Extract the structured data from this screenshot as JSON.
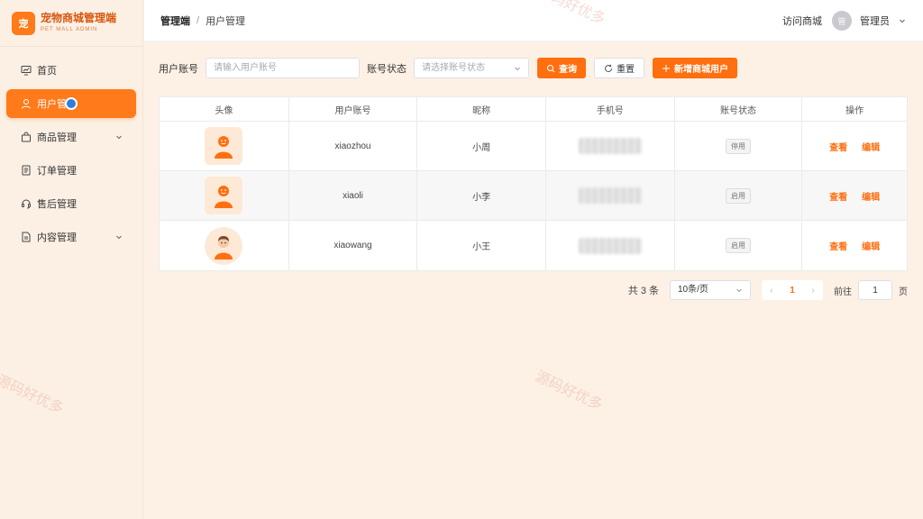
{
  "brand": {
    "logo_char": "宠",
    "title": "宠物商城管理端",
    "subtitle": "PET MALL ADMIN"
  },
  "sidebar": {
    "items": [
      {
        "label": "首页",
        "icon": "dashboard-icon",
        "active": false
      },
      {
        "label": "用户管",
        "icon": "user-icon",
        "active": true
      },
      {
        "label": "商品管理",
        "icon": "bag-icon",
        "active": false,
        "expandable": true
      },
      {
        "label": "订单管理",
        "icon": "document-icon",
        "active": false
      },
      {
        "label": "售后管理",
        "icon": "headset-icon",
        "active": false
      },
      {
        "label": "内容管理",
        "icon": "file-icon",
        "active": false,
        "expandable": true
      }
    ]
  },
  "header": {
    "breadcrumb": [
      "管理端",
      "用户管理"
    ],
    "separator": "/",
    "visit_store": "访问商城",
    "avatar_char": "管",
    "admin_name": "管理员"
  },
  "filter": {
    "account_label": "用户账号",
    "account_placeholder": "请输入用户账号",
    "status_label": "账号状态",
    "status_placeholder": "请选择账号状态",
    "query_button": "查询",
    "reset_button": "重置",
    "add_button": "新增商城用户"
  },
  "table": {
    "columns": [
      "头像",
      "用户账号",
      "昵称",
      "手机号",
      "账号状态",
      "操作"
    ],
    "rows": [
      {
        "account": "xiaozhou",
        "nickname": "小周",
        "status": "停用"
      },
      {
        "account": "xiaoli",
        "nickname": "小李",
        "status": "启用"
      },
      {
        "account": "xiaowang",
        "nickname": "小王",
        "status": "启用"
      }
    ],
    "action_view": "查看",
    "action_edit": "编辑"
  },
  "pagination": {
    "total": "共 3 条",
    "page_size": "10条/页",
    "prev": "‹",
    "next": "›",
    "current": "1",
    "goto_label": "前往",
    "goto_value": "1",
    "page_unit": "页"
  },
  "watermark": "源码好优多",
  "colors": {
    "accent": "#ff6f10",
    "sidebar_bg": "#fcf0e5",
    "page_bg": "#fdf1e6"
  }
}
